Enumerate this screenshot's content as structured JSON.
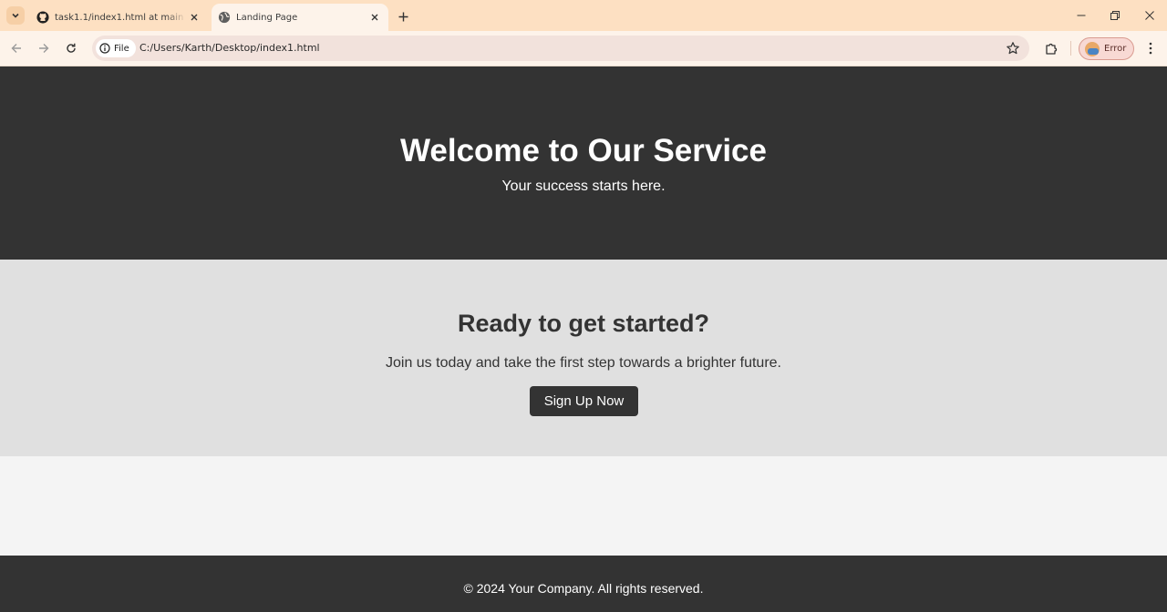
{
  "browser": {
    "tabs": [
      {
        "title": "task1.1/index1.html at main · br",
        "active": false,
        "icon": "github-icon"
      },
      {
        "title": "Landing Page",
        "active": true,
        "icon": "globe-icon"
      }
    ],
    "address": {
      "scheme_label": "File",
      "url": "C:/Users/Karth/Desktop/index1.html"
    },
    "profile_label": "Error",
    "colors": {
      "tabstrip": "#fde0c2",
      "toolbar": "#fdf3ea"
    }
  },
  "page": {
    "hero": {
      "title": "Welcome to Our Service",
      "subtitle": "Your success starts here."
    },
    "cta": {
      "heading": "Ready to get started?",
      "text": "Join us today and take the first step towards a brighter future.",
      "button_label": "Sign Up Now"
    },
    "footer": {
      "text": "© 2024 Your Company. All rights reserved."
    },
    "colors": {
      "dark": "#333333",
      "light_gray": "#e0e0e0",
      "background": "#f4f4f4"
    }
  }
}
